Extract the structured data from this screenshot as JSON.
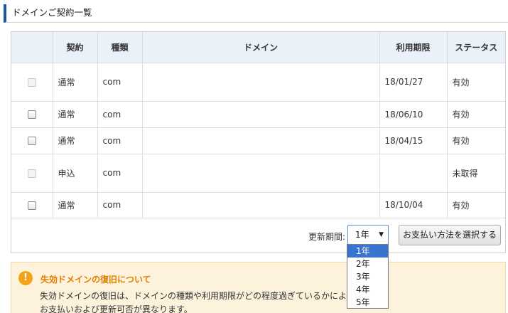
{
  "section": {
    "title": "ドメインご契約一覧"
  },
  "table": {
    "headers": [
      "",
      "契約",
      "種類",
      "ドメイン",
      "利用期限",
      "ステータス"
    ],
    "rows": [
      {
        "checkbox_enabled": false,
        "contract": "通常",
        "type": "com",
        "domain": "",
        "expiry": "18/01/27",
        "status": "有効"
      },
      {
        "checkbox_enabled": true,
        "contract": "通常",
        "type": "com",
        "domain": "",
        "expiry": "18/06/10",
        "status": "有効"
      },
      {
        "checkbox_enabled": true,
        "contract": "通常",
        "type": "com",
        "domain": "",
        "expiry": "18/04/15",
        "status": "有効"
      },
      {
        "checkbox_enabled": false,
        "contract": "申込",
        "type": "com",
        "domain": "",
        "expiry": "",
        "status": "未取得"
      },
      {
        "checkbox_enabled": true,
        "contract": "通常",
        "type": "com",
        "domain": "",
        "expiry": "18/10/04",
        "status": "有効"
      }
    ]
  },
  "renewal": {
    "label": "更新期間:",
    "selected": "1年",
    "options": [
      "1年",
      "2年",
      "3年",
      "4年",
      "5年"
    ],
    "pay_button": "お支払い方法を選択する"
  },
  "notice": {
    "title": "失効ドメインの復旧について",
    "body_line1": "失効ドメインの復旧は、ドメインの種類や利用期限がどの程度過ぎているかによって",
    "body_line2": "お支払いおよび更新可否が異なります。"
  },
  "colors": {
    "accent": "#1b56a6",
    "header_bg": "#eaf1f8",
    "notice_bg": "#fdf3dd",
    "notice_title": "#e07d00",
    "selected_option": "#3874d0"
  },
  "icons": {
    "notice": "exclamation-circle-icon",
    "select_caret": "caret-down-icon"
  }
}
